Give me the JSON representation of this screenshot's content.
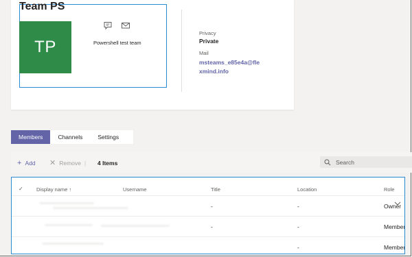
{
  "team": {
    "name": "Team PS",
    "initials": "TP",
    "description": "Powershell test team",
    "avatar_color": "#2e8b48",
    "icons": [
      "chat-icon",
      "mail-icon"
    ]
  },
  "details": {
    "privacy_label": "Privacy",
    "privacy_value": "Private",
    "mail_label": "Mail",
    "mail_value": "msteams_e85e4a@flexmind.info"
  },
  "tabs": [
    {
      "label": "Members",
      "active": true
    },
    {
      "label": "Channels",
      "active": false
    },
    {
      "label": "Settings",
      "active": false
    }
  ],
  "toolbar": {
    "add_label": "Add",
    "remove_label": "Remove",
    "separator": "|",
    "count_label": "4 Items",
    "search_placeholder": "Search"
  },
  "table": {
    "columns": [
      "Display name",
      "Username",
      "Title",
      "Location",
      "Role"
    ],
    "sort_indicator": "↑",
    "rows": [
      {
        "title": "-",
        "location": "-",
        "role": "Owner"
      },
      {
        "title": "-",
        "location": "-",
        "role": "Member"
      },
      {
        "title": "",
        "location": "-",
        "role": "Member"
      }
    ]
  },
  "colors": {
    "accent": "#6264a7",
    "selection_outline": "#2a8ad4"
  }
}
